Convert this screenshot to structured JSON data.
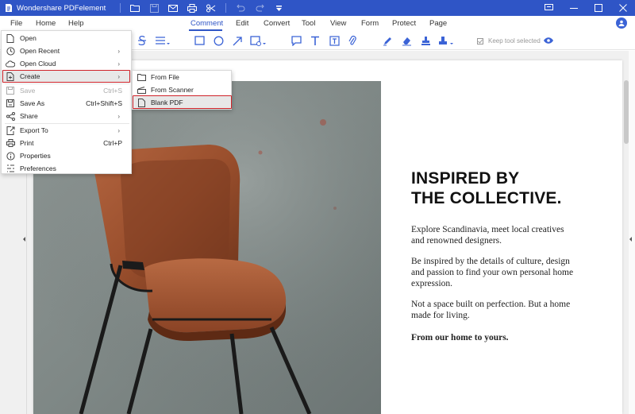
{
  "titlebar": {
    "app_title": "Wondershare PDFelement",
    "colors": {
      "bar": "#2f55c6"
    },
    "quick_access": [
      "folder-icon",
      "save-icon",
      "mail-icon",
      "print-icon",
      "scissors-icon",
      "undo-icon",
      "redo-icon",
      "dropdown-icon"
    ],
    "window_controls": [
      "restore-icon",
      "minimize-icon",
      "maximize-icon",
      "close-icon"
    ]
  },
  "menubar": {
    "left": [
      "File",
      "Home",
      "Help"
    ],
    "tabs": [
      "Comment",
      "Edit",
      "Convert",
      "Tool",
      "View",
      "Form",
      "Protect",
      "Page"
    ],
    "active_tab": "Comment"
  },
  "toolbar": {
    "tools": [
      "strikethrough-icon",
      "lines-icon",
      "rectangle-icon",
      "circle-icon",
      "arrow-icon",
      "shape-icon",
      "note-icon",
      "text-icon",
      "textbox-icon",
      "attachment-icon",
      "pen-icon",
      "eraser-icon",
      "stamp-icon",
      "signature-icon",
      "eye-icon"
    ],
    "keep_tool_label": "Keep tool selected"
  },
  "file_menu": {
    "items": [
      {
        "label": "Open",
        "shortcut": "",
        "submenu": false,
        "disabled": false
      },
      {
        "label": "Open Recent",
        "shortcut": "",
        "submenu": true,
        "disabled": false
      },
      {
        "label": "Open Cloud",
        "shortcut": "",
        "submenu": true,
        "disabled": false
      },
      {
        "label": "Create",
        "shortcut": "",
        "submenu": true,
        "disabled": false
      },
      {
        "label": "Save",
        "shortcut": "Ctrl+S",
        "submenu": false,
        "disabled": true
      },
      {
        "label": "Save As",
        "shortcut": "Ctrl+Shift+S",
        "submenu": false,
        "disabled": false
      },
      {
        "label": "Share",
        "shortcut": "",
        "submenu": true,
        "disabled": false
      },
      {
        "label": "Export To",
        "shortcut": "",
        "submenu": true,
        "disabled": false
      },
      {
        "label": "Print",
        "shortcut": "Ctrl+P",
        "submenu": false,
        "disabled": false
      },
      {
        "label": "Properties",
        "shortcut": "",
        "submenu": false,
        "disabled": false
      },
      {
        "label": "Preferences",
        "shortcut": "",
        "submenu": false,
        "disabled": false
      }
    ],
    "arrow_glyph": "›"
  },
  "create_submenu": {
    "items": [
      "From File",
      "From Scanner",
      "Blank PDF"
    ]
  },
  "document": {
    "heading_line1": "INSPIRED BY",
    "heading_line2": "THE COLLECTIVE.",
    "p1": "Explore Scandinavia, meet local creatives and renowned designers.",
    "p2": "Be inspired by the details of culture, design and passion to find your own personal home expression.",
    "p3": "Not a space built on perfection. But a home made for living.",
    "p4": "From our home to yours."
  },
  "highlight_color": "#d0232a"
}
